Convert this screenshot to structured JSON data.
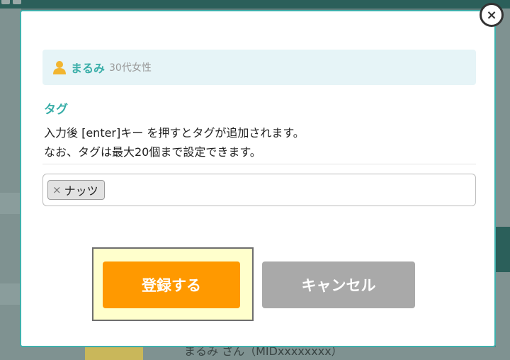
{
  "background": {
    "bottom_text": "まるみ さん（MIDxxxxxxxx）"
  },
  "dialog": {
    "close_symbol": "×",
    "user": {
      "name": "まるみ",
      "meta": "30代女性",
      "icon": "person-icon"
    },
    "tag_heading": "タグ",
    "help_lines": [
      "入力後 [enter]キー を押すとタグが追加されます。",
      "なお、タグは最大20個まで設定できます。"
    ],
    "tags": [
      {
        "remove_symbol": "×",
        "label": "ナッツ"
      }
    ],
    "tag_input": {
      "value": "",
      "placeholder": ""
    },
    "buttons": {
      "register": "登録する",
      "cancel": "キャンセル"
    }
  },
  "colors": {
    "accent": "#3fb0ac",
    "register_button": "#ff9900",
    "cancel_button": "#a9a9a9",
    "focus_highlight": "#ffffcc"
  }
}
